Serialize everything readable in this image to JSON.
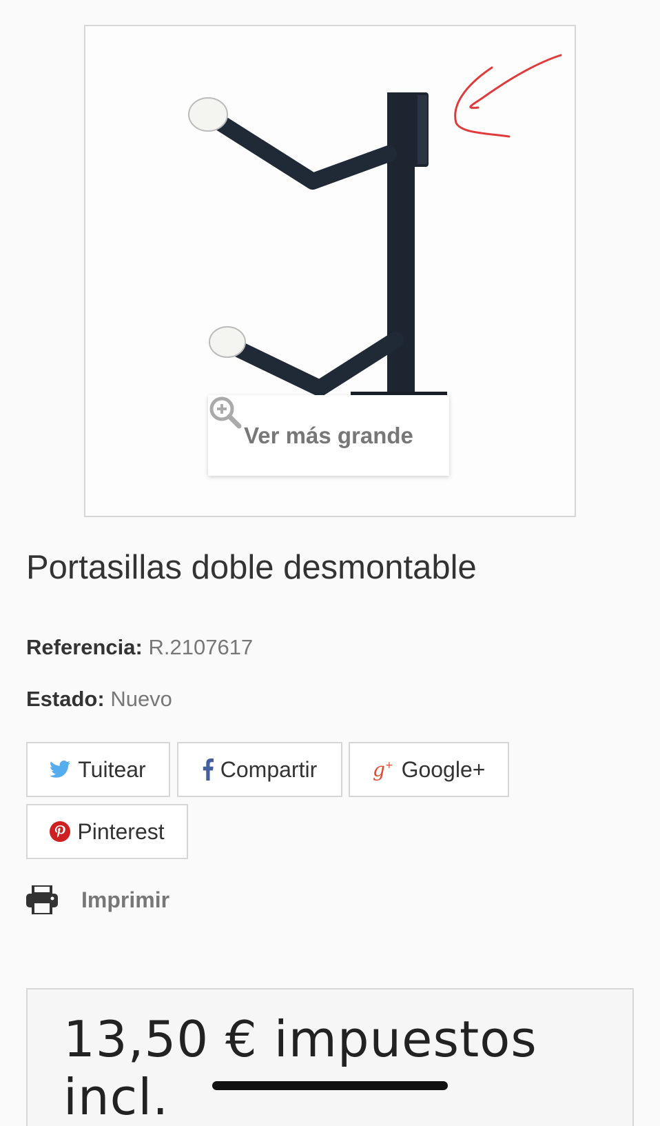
{
  "product": {
    "zoom_label": "Ver más grande",
    "title": "Portasillas doble desmontable",
    "reference_label": "Referencia:",
    "reference_value": "R.2107617",
    "state_label": "Estado:",
    "state_value": "Nuevo"
  },
  "share": {
    "twitter": "Tuitear",
    "facebook": "Compartir",
    "google": "Google+",
    "pinterest": "Pinterest"
  },
  "print": {
    "label": "Imprimir"
  },
  "price": {
    "text": "13,50 € impuestos incl."
  },
  "colors": {
    "twitter": "#55acee",
    "facebook": "#435f9f",
    "google": "#e04b34",
    "pinterest": "#ce1f21",
    "annotation": "#e03a3a"
  },
  "icons": {
    "zoom": "zoom-in-icon",
    "twitter": "twitter-icon",
    "facebook": "facebook-icon",
    "google": "google-plus-icon",
    "pinterest": "pinterest-icon",
    "print": "printer-icon"
  }
}
